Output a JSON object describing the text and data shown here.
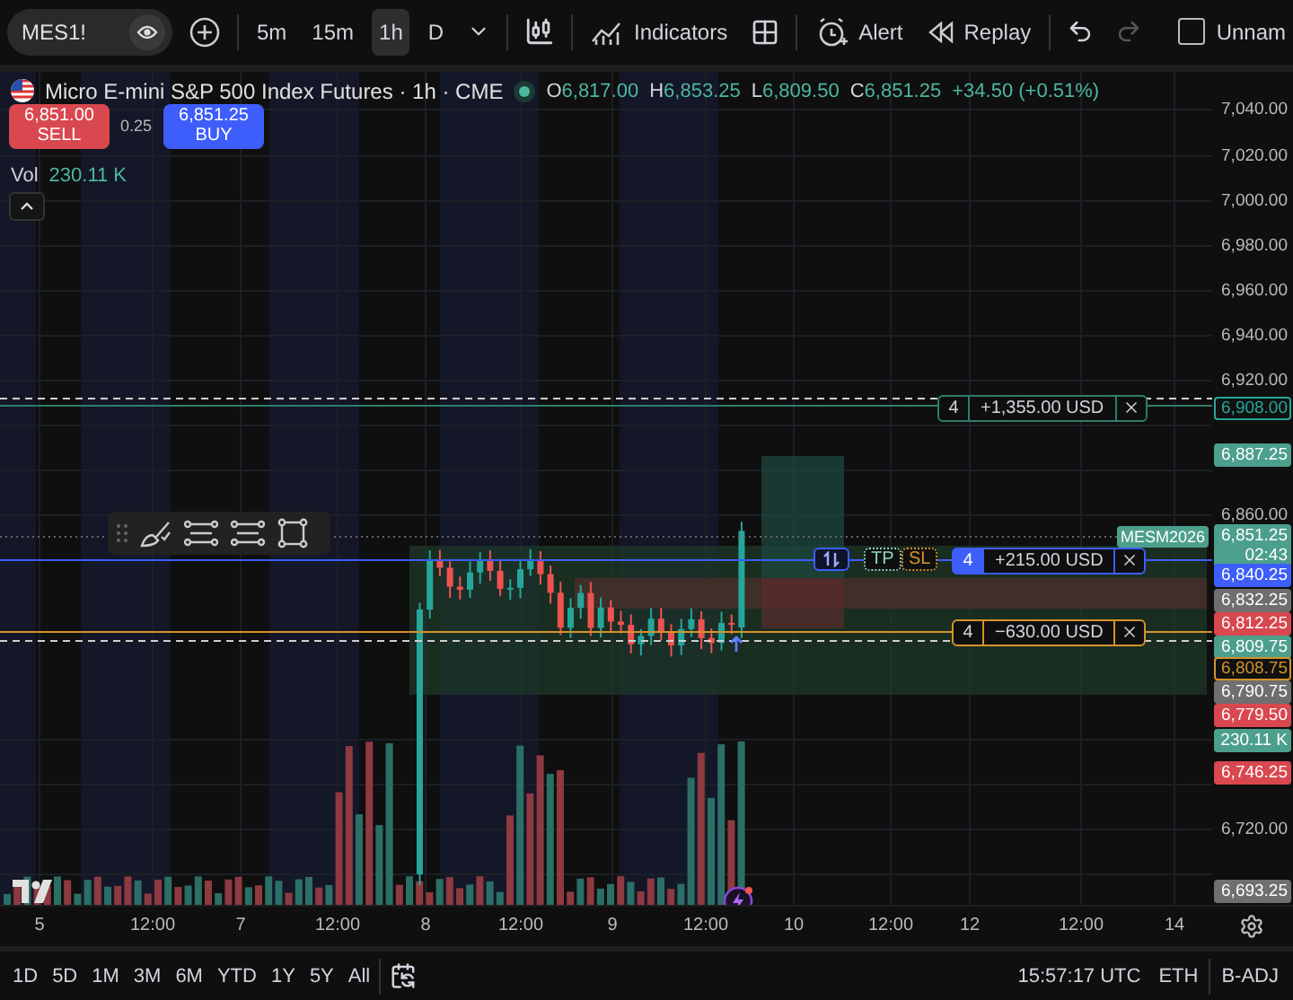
{
  "toolbar": {
    "symbol": "MES1!",
    "intervals": [
      {
        "label": "5m",
        "selected": false
      },
      {
        "label": "15m",
        "selected": false
      },
      {
        "label": "1h",
        "selected": true
      },
      {
        "label": "D",
        "selected": false
      }
    ],
    "indicators": "Indicators",
    "alert": "Alert",
    "replay": "Replay",
    "undo": {
      "disabled": false
    },
    "redo": {
      "disabled": true
    },
    "layout_name": "Unnam"
  },
  "legend": {
    "title": "Micro E-mini S&P 500 Index Futures · 1h · CME",
    "ohlc": [
      {
        "key": "O",
        "value": "6,817.00"
      },
      {
        "key": "H",
        "value": "6,853.25"
      },
      {
        "key": "L",
        "value": "6,809.50"
      },
      {
        "key": "C",
        "value": "6,851.25"
      }
    ],
    "change": "+34.50 (+0.51%)",
    "sell": {
      "price": "6,851.00",
      "label": "SELL"
    },
    "spread": "0.25",
    "buy": {
      "price": "6,851.25",
      "label": "BUY"
    },
    "volume": {
      "label": "Vol",
      "value": "230.11 K"
    }
  },
  "orders": [
    {
      "kind": "take_profit",
      "qty": "4",
      "pnl": "+1,355.00 USD"
    },
    {
      "kind": "position",
      "qty": "4",
      "pnl": "+215.00 USD",
      "brackets": [
        "TP",
        "SL"
      ]
    },
    {
      "kind": "stop_loss",
      "qty": "4",
      "pnl": "−630.00 USD"
    }
  ],
  "symbol_label": "MESM2026",
  "price_axis": {
    "ticks": [
      "7,040.00",
      "7,020.00",
      "7,000.00",
      "6,980.00",
      "6,960.00",
      "6,940.00",
      "6,920.00",
      "6,860.00",
      "6,720.00"
    ],
    "badges": [
      {
        "text": "6,908.00",
        "kind": "outlined",
        "color": "#26a69a"
      },
      {
        "text": "6,887.25",
        "kind": "filled",
        "color": "#4c9f8c"
      },
      {
        "text": "6,851.25",
        "sub": "02:43",
        "kind": "filled",
        "color": "#4c9f8c"
      },
      {
        "text": "6,840.25",
        "kind": "filled",
        "color": "#3d5efa"
      },
      {
        "text": "6,832.25",
        "kind": "filled",
        "color": "#6f6f6f"
      },
      {
        "text": "6,812.25",
        "kind": "filled",
        "color": "#d9474f"
      },
      {
        "text": "6,809.75",
        "kind": "filled",
        "color": "#4c9f8c"
      },
      {
        "text": "6,808.75",
        "kind": "outlined",
        "color": "#d4932a"
      },
      {
        "text": "6,790.75",
        "kind": "filled",
        "color": "#6f6f6f"
      },
      {
        "text": "6,779.50",
        "kind": "filled",
        "color": "#d9474f"
      },
      {
        "text": "230.11 K",
        "kind": "filled",
        "color": "#4c9f8c"
      },
      {
        "text": "6,746.25",
        "kind": "filled",
        "color": "#d9474f"
      },
      {
        "text": "6,693.25",
        "kind": "filled",
        "color": "#6f6f6f"
      }
    ]
  },
  "time_axis": [
    "5",
    "12:00",
    "7",
    "12:00",
    "8",
    "12:00",
    "9",
    "12:00",
    "10",
    "12:00",
    "12",
    "12:00",
    "14"
  ],
  "ranges": [
    "1D",
    "5D",
    "1M",
    "3M",
    "6M",
    "YTD",
    "1Y",
    "5Y",
    "All"
  ],
  "status": {
    "time": "15:57:17 UTC",
    "session": "ETH",
    "adjustment": "B-ADJ"
  }
}
